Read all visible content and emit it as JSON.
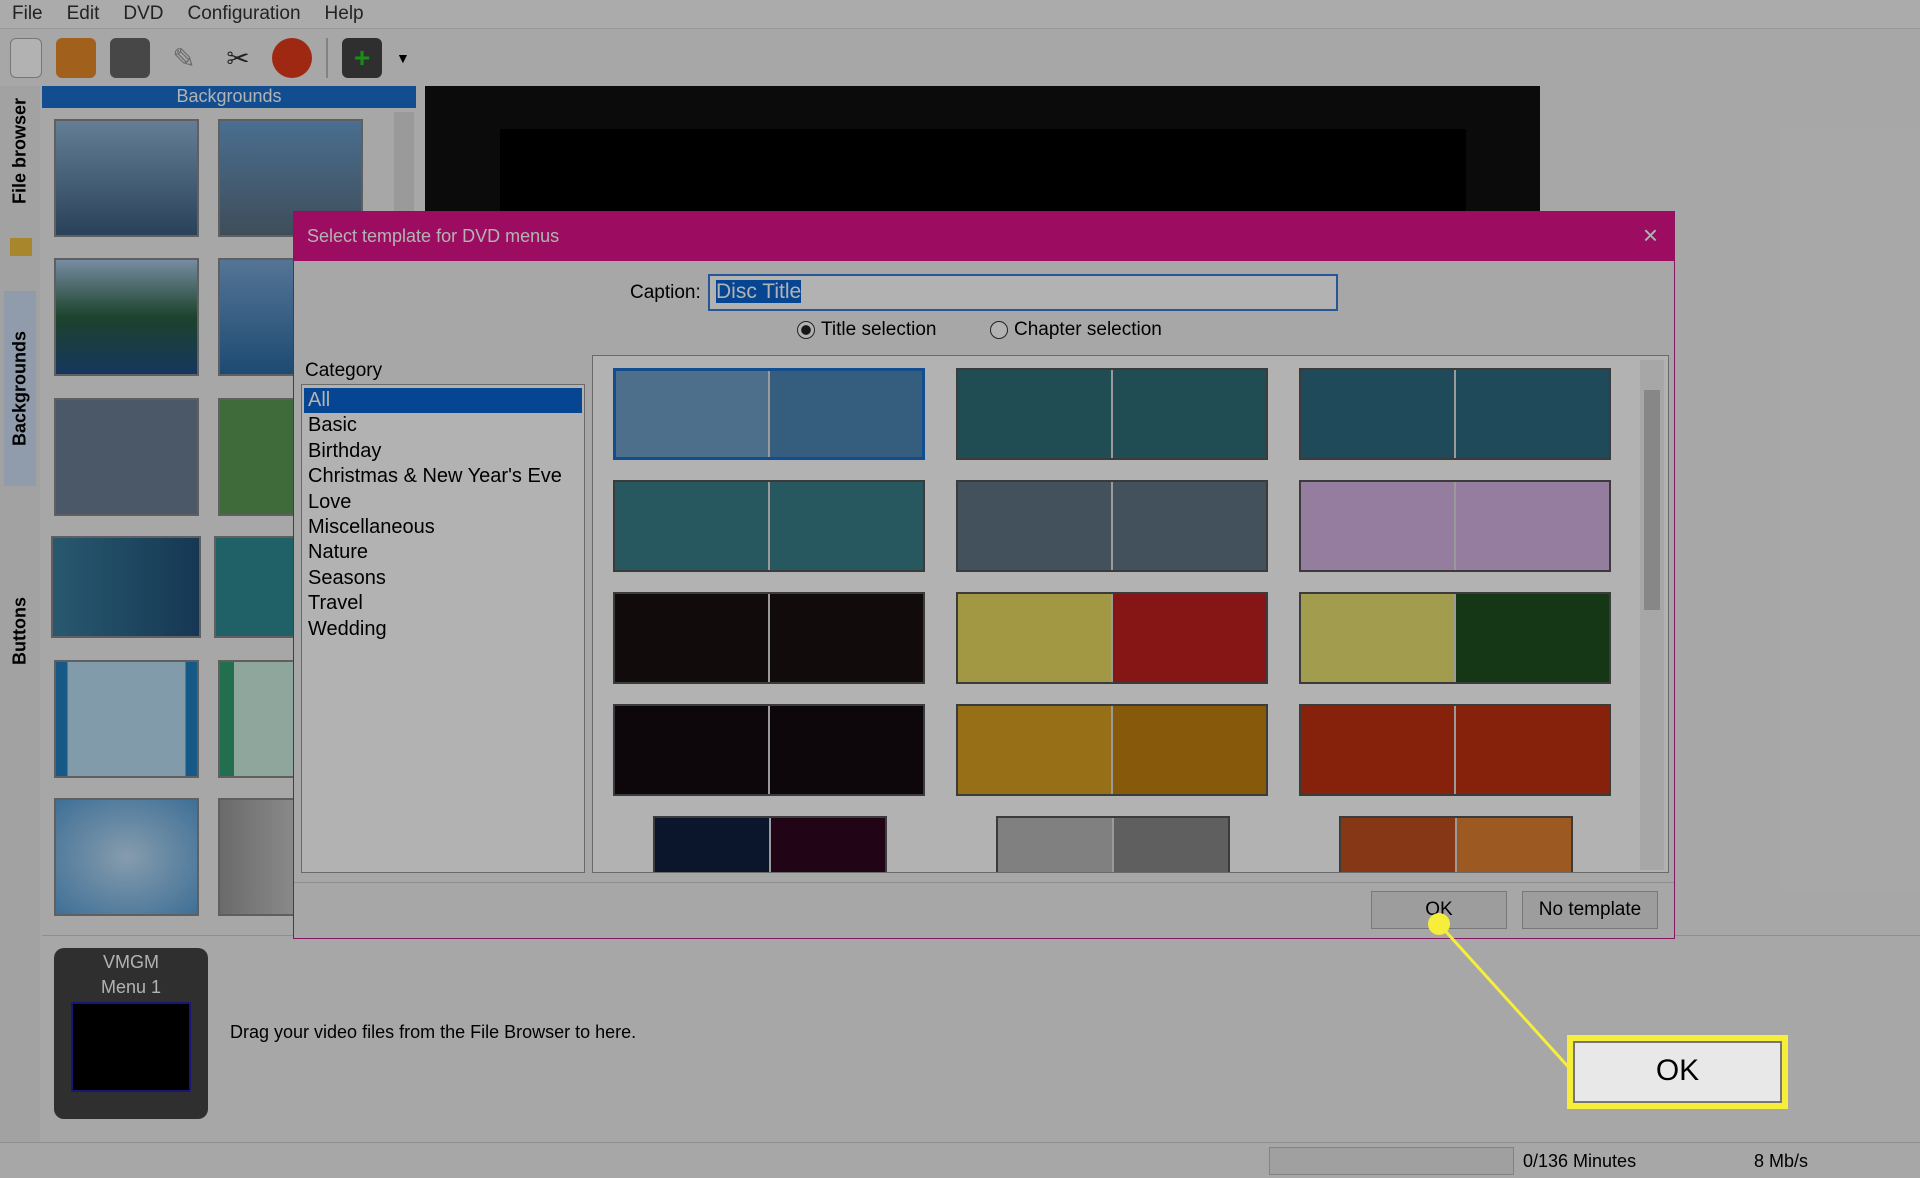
{
  "menu": [
    "File",
    "Edit",
    "DVD",
    "Configuration",
    "Help"
  ],
  "toolbar": {
    "icons": [
      "new-project-icon",
      "open-folder-icon",
      "save-icon",
      "settings-wand-icon",
      "tools-icon",
      "burn-disc-icon",
      "add-video-icon",
      "dropdown-arrow-icon"
    ]
  },
  "side_tabs": [
    "File browser",
    "Backgrounds",
    "Buttons"
  ],
  "backgrounds_panel": {
    "title": "Backgrounds"
  },
  "bottom": {
    "vmgm": "VMGM",
    "menu": "Menu 1",
    "hint": "Drag your video files from the File Browser to here."
  },
  "status": {
    "minutes": "0/136 Minutes",
    "rate": "8 Mb/s",
    "progress": 0
  },
  "dialog": {
    "title": "Select template for DVD menus",
    "caption_label": "Caption:",
    "caption_value": "Disc Title",
    "radio_title": "Title selection",
    "radio_chapter": "Chapter selection",
    "selected_radio": "Title selection",
    "category_label": "Category",
    "categories": [
      "All",
      "Basic",
      "Birthday",
      "Christmas & New Year's Eve",
      "Love",
      "Miscellaneous",
      "Nature",
      "Seasons",
      "Travel",
      "Wedding"
    ],
    "selected_category": "All",
    "ok": "OK",
    "no_template": "No template"
  },
  "callout": {
    "label": "OK",
    "color": "#f6ee3a"
  },
  "accent": "#e0148c"
}
